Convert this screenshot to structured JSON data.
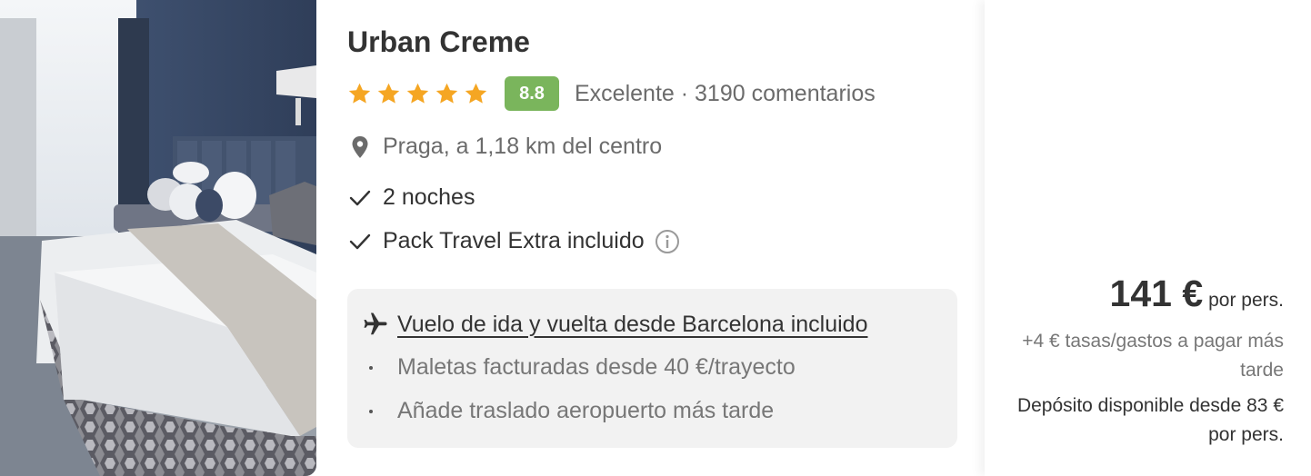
{
  "hotel": {
    "name": "Urban Creme",
    "stars": 5,
    "score": "8.8",
    "rating_text": "Excelente · 3190 comentarios",
    "location": "Praga, a 1,18 km del centro",
    "features": [
      "2 noches",
      "Pack Travel Extra incluido"
    ]
  },
  "flight": {
    "title": "Vuelo de ida y vuelta desde Barcelona incluido",
    "details": [
      "Maletas facturadas desde 40 €/trayecto",
      "Añade traslado aeropuerto más tarde"
    ]
  },
  "price": {
    "amount": "141 €",
    "unit": "por pers.",
    "taxes": "+4 € tasas/gastos a pagar más tarde",
    "deposit": "Depósito disponible desde 83 € por pers."
  },
  "icons": {
    "star": "star-icon",
    "location": "map-pin-icon",
    "check": "checkmark-icon",
    "info": "info-icon",
    "plane": "airplane-icon"
  },
  "colors": {
    "star": "#f5a623",
    "score_badge": "#7ab55c",
    "flight_box_bg": "#f2f2f2",
    "text_primary": "#333333",
    "text_secondary": "#6b6b6b"
  }
}
